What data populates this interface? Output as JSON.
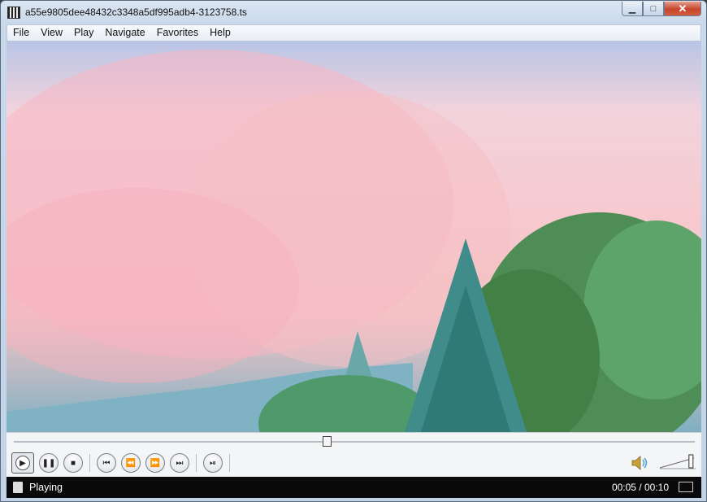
{
  "window": {
    "title": "a55e9805dee48432c3348a5df995adb4-3123758.ts"
  },
  "caption": {
    "minimize": "▁",
    "maximize": "□",
    "close": "✕"
  },
  "menu": [
    "File",
    "View",
    "Play",
    "Navigate",
    "Favorites",
    "Help"
  ],
  "playback": {
    "position": "00:05",
    "duration": "00:10",
    "progress": 0.46,
    "volume": 0.9
  },
  "controls": {
    "play": "▶",
    "pause": "❚❚",
    "stop": "■",
    "prev": "⏮",
    "rewind": "⏪",
    "forward": "⏩",
    "next": "⏭",
    "frame_step": "⏯"
  },
  "status": {
    "state": "Playing",
    "time_display": "00:05 / 00:10"
  },
  "colors": {
    "titlebar": "#c9d8ea",
    "statusbar": "#0a0a0a",
    "volume_icon": "#c7a23a"
  }
}
